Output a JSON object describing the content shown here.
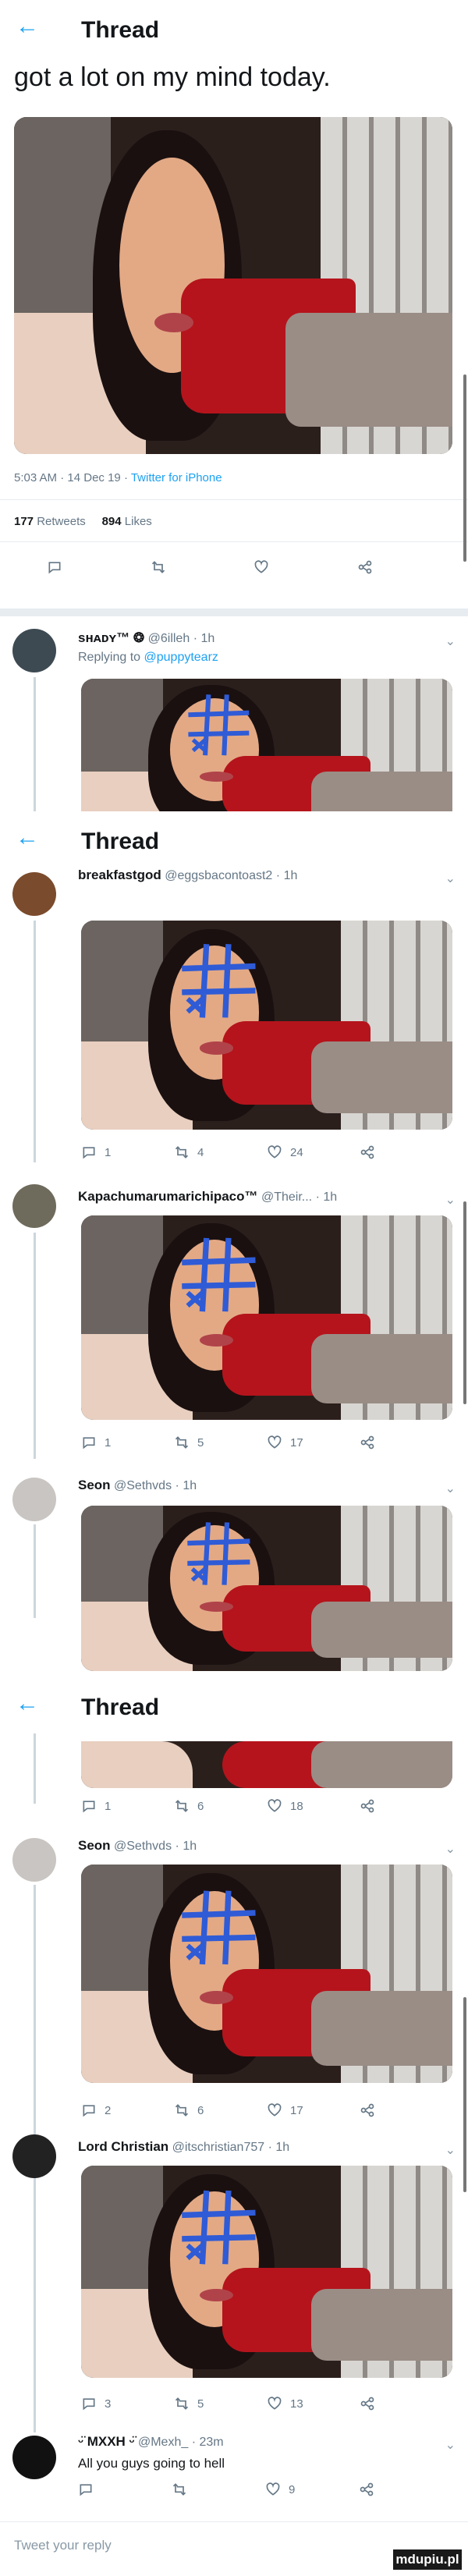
{
  "headers": {
    "thread_title": "Thread",
    "back_glyph": "←"
  },
  "main_tweet": {
    "text": "got a lot on my mind today.",
    "time": "5:03 AM",
    "date": "14 Dec 19",
    "source": "Twitter for iPhone",
    "retweets_count": "177",
    "retweets_label": "Retweets",
    "likes_count": "894",
    "likes_label": "Likes"
  },
  "replies": [
    {
      "name": "sʜᴀᴅʏ™ ❂",
      "handle": "@6illeh",
      "time": "1h",
      "replying_prefix": "Replying to",
      "replying_handle": "@puppytearz"
    },
    {
      "name": "breakfastgod",
      "handle": "@eggsbacontoast2",
      "time": "1h",
      "replies": "1",
      "retweets": "4",
      "likes": "24"
    },
    {
      "name": "Kapachumarumarichipaco™",
      "handle": "@Their...",
      "time": "1h",
      "replies": "1",
      "retweets": "5",
      "likes": "17"
    },
    {
      "name": "Seon",
      "handle": "@Sethvds",
      "time": "1h"
    },
    {
      "replies": "1",
      "retweets": "6",
      "likes": "18"
    },
    {
      "name": "Seon",
      "handle": "@Sethvds",
      "time": "1h",
      "replies": "2",
      "retweets": "6",
      "likes": "17"
    },
    {
      "name": "Lord Christian",
      "handle": "@itschristian757",
      "time": "1h",
      "replies": "3",
      "retweets": "5",
      "likes": "13"
    },
    {
      "name": "ᵕ̈ MXXH ᵕ̈",
      "handle": "@Mexh_",
      "time": "23m",
      "text": "All you guys going to hell",
      "likes": "9"
    }
  ],
  "reply_box": {
    "placeholder": "Tweet your reply"
  },
  "watermark": "mdupiu.pl",
  "icons": [
    "back-arrow-icon",
    "reply-icon",
    "retweet-icon",
    "like-icon",
    "share-icon",
    "chevron-down-icon"
  ],
  "colors": {
    "accent": "#1da1f2",
    "muted": "#657786",
    "text": "#14171a"
  }
}
